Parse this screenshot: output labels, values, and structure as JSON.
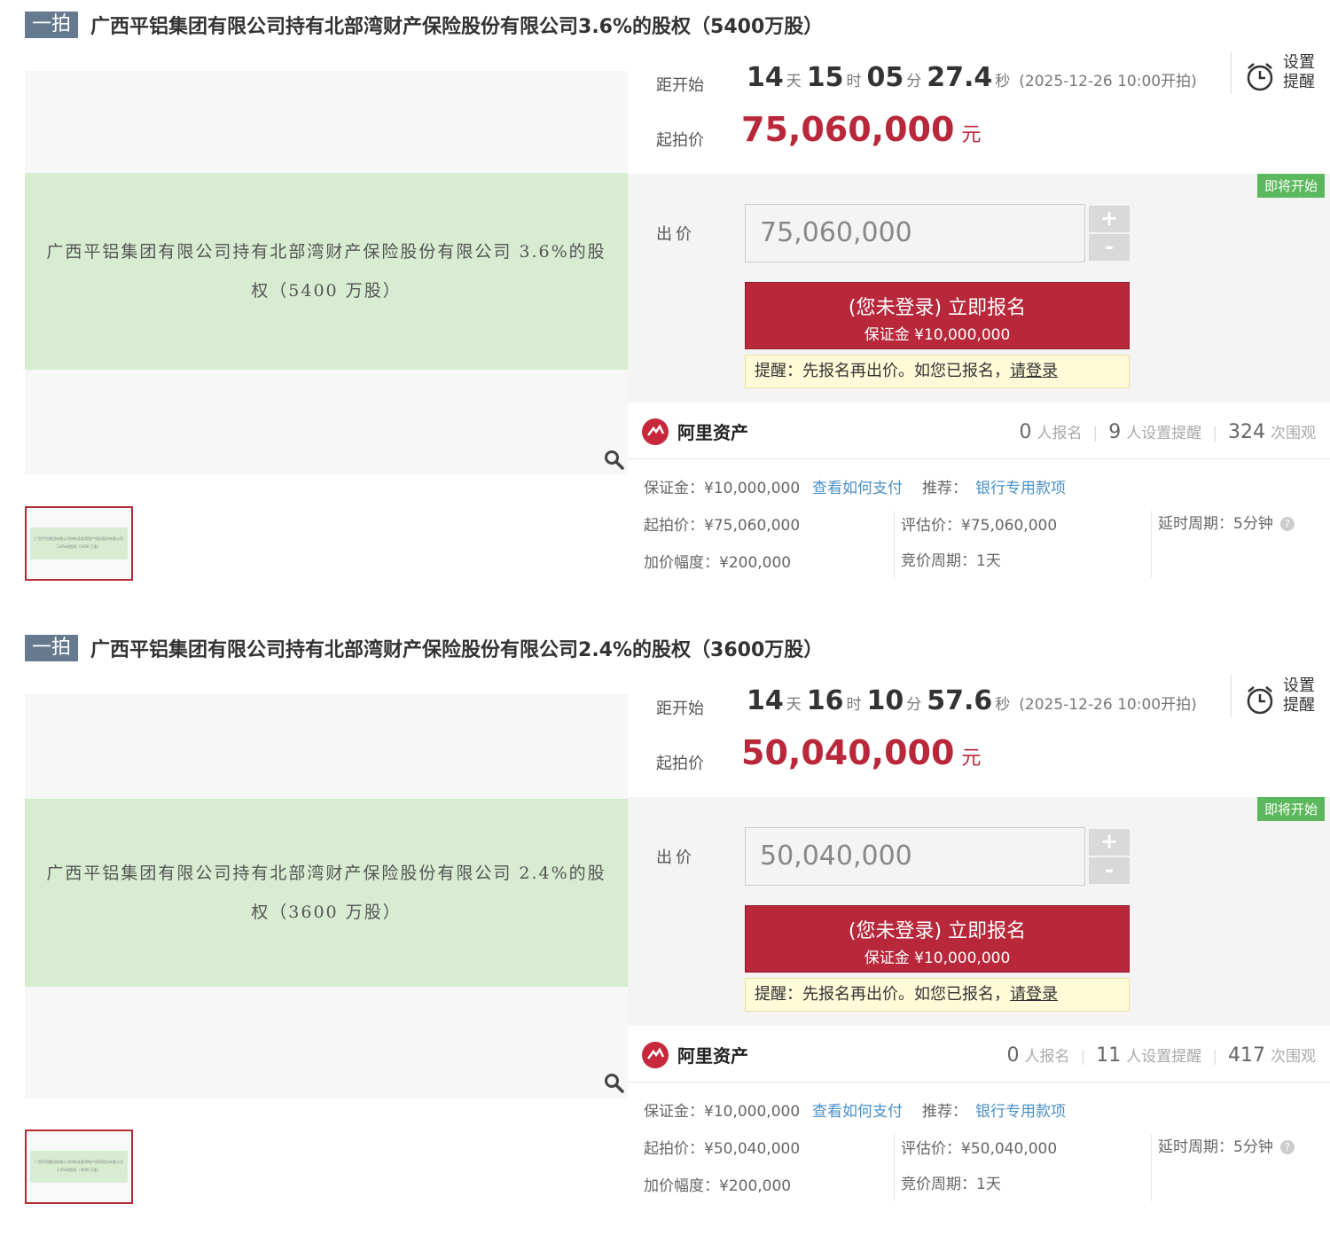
{
  "auctions": [
    {
      "tag": "一拍",
      "title": "广西平铝集团有限公司持有北部湾财产保险股份有限公司3.6%的股权（5400万股）",
      "image_text": "广西平铝集团有限公司持有北部湾财产保险股份有限公司 3.6%的股权（5400 万股）",
      "countdown_label": "距开始",
      "countdown": {
        "days": "14",
        "days_unit": "天",
        "hours": "15",
        "hours_unit": "时",
        "minutes": "05",
        "minutes_unit": "分",
        "seconds": "27.4",
        "seconds_unit": "秒",
        "note": "(2025-12-26 10:00开拍)"
      },
      "start_price_label": "起拍价",
      "start_price": "75,060,000",
      "price_unit": "元",
      "remind_label": "设置提醒",
      "soon_badge": "即将开始",
      "bid_label": "出价",
      "bid_value": "75,060,000",
      "plus": "+",
      "minus": "-",
      "signup_main": "(您未登录) 立即报名",
      "signup_sub": "保证金 ¥10,000,000",
      "hint_text": "提醒：先报名再出价。如您已报名，",
      "hint_link": "请登录",
      "platform": "阿里资产",
      "signups": "0",
      "signups_label": "人报名",
      "reminders": "9",
      "reminders_label": "人设置提醒",
      "views": "324",
      "views_label": "次围观",
      "deposit": "保证金：¥10,000,000",
      "pay_link": "查看如何支付",
      "recommend_label": "推荐：",
      "recommend_link": "银行专用款项",
      "detail_start_price": "起拍价：¥75,060,000",
      "detail_eval_price": "评估价：¥75,060,000",
      "detail_delay": "延时周期：5分钟",
      "detail_increment": "加价幅度：¥200,000",
      "detail_cycle": "竞价周期：1天"
    },
    {
      "tag": "一拍",
      "title": "广西平铝集团有限公司持有北部湾财产保险股份有限公司2.4%的股权（3600万股）",
      "image_text": "广西平铝集团有限公司持有北部湾财产保险股份有限公司 2.4%的股权（3600 万股）",
      "countdown_label": "距开始",
      "countdown": {
        "days": "14",
        "days_unit": "天",
        "hours": "16",
        "hours_unit": "时",
        "minutes": "10",
        "minutes_unit": "分",
        "seconds": "57.6",
        "seconds_unit": "秒",
        "note": "(2025-12-26 10:00开拍)"
      },
      "start_price_label": "起拍价",
      "start_price": "50,040,000",
      "price_unit": "元",
      "remind_label": "设置提醒",
      "soon_badge": "即将开始",
      "bid_label": "出价",
      "bid_value": "50,040,000",
      "plus": "+",
      "minus": "-",
      "signup_main": "(您未登录) 立即报名",
      "signup_sub": "保证金 ¥10,000,000",
      "hint_text": "提醒：先报名再出价。如您已报名，",
      "hint_link": "请登录",
      "platform": "阿里资产",
      "signups": "0",
      "signups_label": "人报名",
      "reminders": "11",
      "reminders_label": "人设置提醒",
      "views": "417",
      "views_label": "次围观",
      "deposit": "保证金：¥10,000,000",
      "pay_link": "查看如何支付",
      "recommend_label": "推荐：",
      "recommend_link": "银行专用款项",
      "detail_start_price": "起拍价：¥50,040,000",
      "detail_eval_price": "评估价：¥50,040,000",
      "detail_delay": "延时周期：5分钟",
      "detail_increment": "加价幅度：¥200,000",
      "detail_cycle": "竞价周期：1天"
    }
  ],
  "colors": {
    "accent": "#b8273a",
    "image_bg": "#d7ecd1",
    "badge": "#5cb85c",
    "tag": "#667a8f",
    "link": "#4a90c8"
  },
  "icons": [
    "magnify-icon",
    "alarm-clock-icon",
    "ali-logo-icon",
    "help-icon"
  ]
}
